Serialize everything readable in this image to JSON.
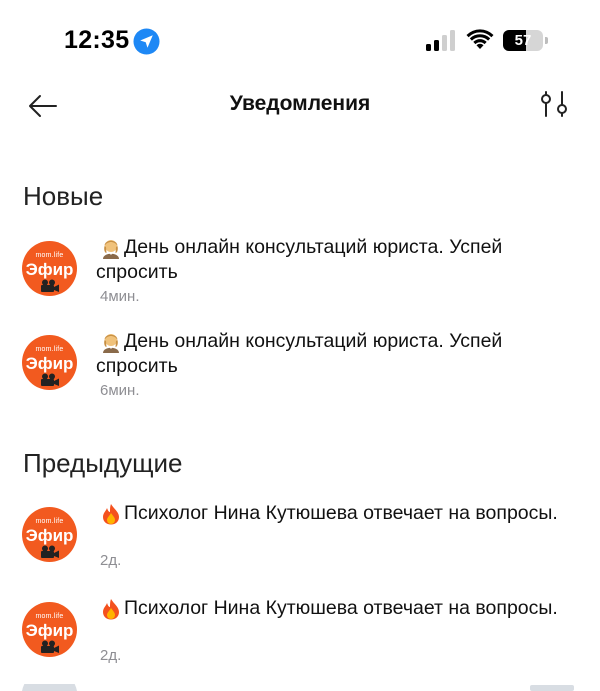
{
  "status_bar": {
    "time": "12:35",
    "battery": "57",
    "battery_level": 0.57
  },
  "header": {
    "title": "Уведомления"
  },
  "sections": {
    "new": {
      "title": "Новые",
      "items": [
        {
          "avatar_small": "mom.life",
          "avatar_big": "Эфир",
          "emoji": "woman-office-worker-emoji",
          "text": "День онлайн консультаций юриста. Успей спросить",
          "time": "4мин."
        },
        {
          "avatar_small": "mom.life",
          "avatar_big": "Эфир",
          "emoji": "woman-office-worker-emoji",
          "text": "День онлайн консультаций юриста. Успей спросить",
          "time": "6мин."
        }
      ]
    },
    "previous": {
      "title": "Предыдущие",
      "items": [
        {
          "avatar_small": "mom.life",
          "avatar_big": "Эфир",
          "emoji": "fire-emoji",
          "text": "Психолог Нина Кутюшева отвечает на вопросы.",
          "time": "2д."
        },
        {
          "avatar_small": "mom.life",
          "avatar_big": "Эфир",
          "emoji": "fire-emoji",
          "text": "Психолог Нина Кутюшева отвечает на вопросы.",
          "time": "2д."
        }
      ]
    }
  },
  "colors": {
    "brand_orange": "#f25a1f",
    "location_blue": "#1e88f5",
    "muted_text": "#8e8e93"
  }
}
